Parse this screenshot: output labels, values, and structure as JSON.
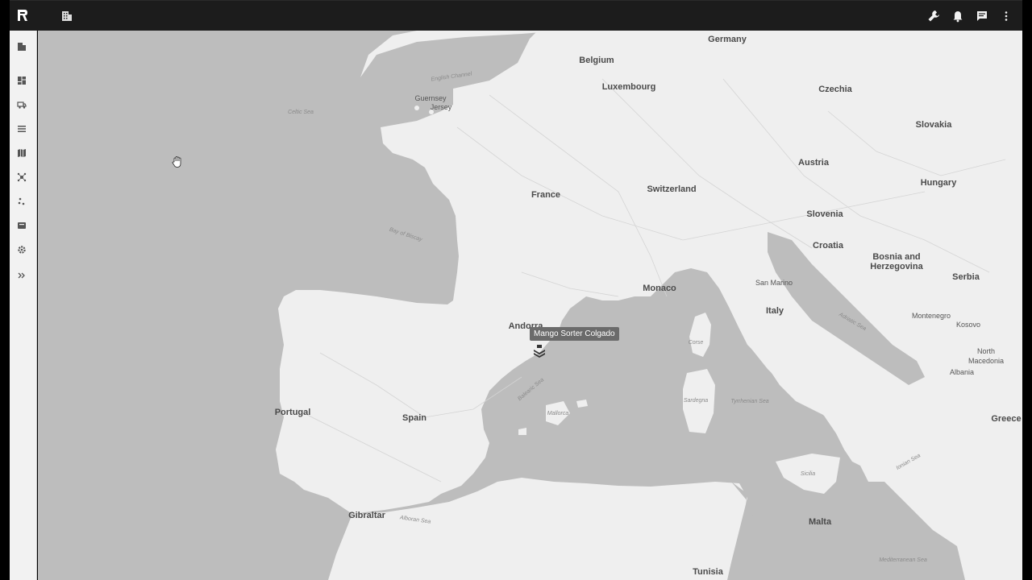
{
  "topbar": {
    "icons": [
      "app-logo",
      "building-icon",
      "wrench-icon",
      "bell-icon",
      "chat-icon",
      "more-vert-icon"
    ]
  },
  "sidebar": {
    "icons": [
      "building-icon",
      "dashboard-icon",
      "truck-icon",
      "list-icon",
      "map-icon",
      "network-icon",
      "dots-icon",
      "box-icon",
      "gear-icon",
      "expand-icon"
    ]
  },
  "map": {
    "marker_tooltip": "Mango Sorter Colgado",
    "countries": {
      "germany": "Germany",
      "belgium": "Belgium",
      "luxembourg": "Luxembourg",
      "czechia": "Czechia",
      "slovakia": "Slovakia",
      "austria": "Austria",
      "hungary": "Hungary",
      "switzerland": "Switzerland",
      "france": "France",
      "slovenia": "Slovenia",
      "croatia": "Croatia",
      "bosnia": "Bosnia and\nHerzegovina",
      "serbia": "Serbia",
      "monaco": "Monaco",
      "san_marino": "San Marino",
      "italy": "Italy",
      "montenegro": "Montenegro",
      "kosovo": "Kosovo",
      "north_macedonia": "North\nMacedonia",
      "albania": "Albania",
      "andorra": "Andorra",
      "portugal": "Portugal",
      "spain": "Spain",
      "greece": "Greece",
      "gibraltar": "Gibraltar",
      "malta": "Malta",
      "tunisia": "Tunisia",
      "guernsey": "Guernsey",
      "jersey": "Jersey"
    },
    "places": {
      "corse": "Corse",
      "sardegna": "Sardegna",
      "mallorca": "Mallorca",
      "sicilia": "Sicilia"
    },
    "seas": {
      "english_channel": "English Channel",
      "celtic_sea": "Celtic Sea",
      "bay_of_biscay": "Bay of Biscay",
      "balearic_sea": "Balearic Sea",
      "tyrrhenian_sea": "Tyrrhenian Sea",
      "adriatic_sea": "Adriatic Sea",
      "ionian_sea": "Ionian Sea",
      "alboran_sea": "Alboran Sea",
      "mediterranean_sea": "Mediterranean Sea"
    }
  }
}
